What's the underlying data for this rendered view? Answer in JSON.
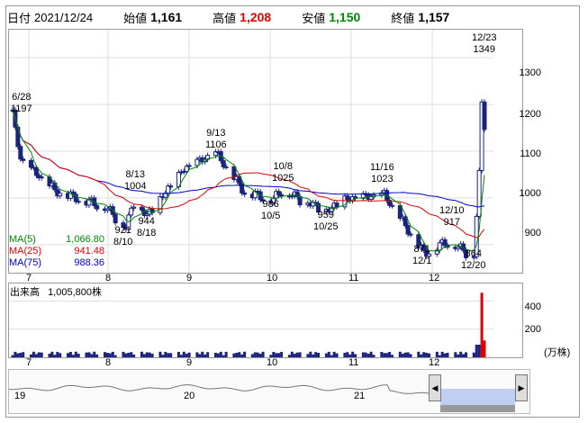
{
  "header": {
    "date_label": "日付",
    "date_value": "2021/12/24",
    "open_label": "始値",
    "open_value": "1,161",
    "high_label": "高値",
    "high_value": "1,208",
    "low_label": "安値",
    "low_value": "1,150",
    "close_label": "終値",
    "close_value": "1,157"
  },
  "price_axis": [
    "1300",
    "1200",
    "1100",
    "1000",
    "900"
  ],
  "month_labels": [
    "7",
    "8",
    "9",
    "10",
    "11",
    "12"
  ],
  "annotations": [
    {
      "text": "6/28\n1197"
    },
    {
      "text": "8/13\n1004"
    },
    {
      "text": "9/13\n1106"
    },
    {
      "text": "10/8\n1025"
    },
    {
      "text": "11/16\n1023"
    },
    {
      "text": "12/23\n1349"
    },
    {
      "text": "921\n8/10"
    },
    {
      "text": "944\n8/18"
    },
    {
      "text": "986\n10/5"
    },
    {
      "text": "959\n10/25"
    },
    {
      "text": "12/10\n917"
    },
    {
      "text": "871\n12/1"
    },
    {
      "text": "864\n12/20"
    }
  ],
  "ma": [
    {
      "label": "MA(5)",
      "value": "1,066.80",
      "color": "#008800"
    },
    {
      "label": "MA(25)",
      "value": "941.48",
      "color": "#e00000"
    },
    {
      "label": "MA(75)",
      "value": "988.36",
      "color": "#0000cc"
    }
  ],
  "volume": {
    "title": "出来高",
    "value": "1,005,800株",
    "axis": [
      "400",
      "200"
    ],
    "unit": "(万株)"
  },
  "nav": {
    "year_labels": [
      "19",
      "20",
      "21"
    ]
  },
  "colors": {
    "candle_up": "#ffffff",
    "candle_down": "#1a237e",
    "ma5": "#008800",
    "ma25": "#e00000",
    "ma75": "#0000cc",
    "volume": "#1a237e",
    "volume_hi": "#e00000",
    "nav_fill": "#b0c4f0"
  },
  "chart_data": {
    "type": "candlestick",
    "x": [
      "2021-06-28",
      "2021-07-01",
      "2021-07-15",
      "2021-08-02",
      "2021-08-10",
      "2021-08-13",
      "2021-08-18",
      "2021-09-01",
      "2021-09-13",
      "2021-09-24",
      "2021-10-05",
      "2021-10-08",
      "2021-10-25",
      "2021-11-01",
      "2021-11-16",
      "2021-12-01",
      "2021-12-10",
      "2021-12-20",
      "2021-12-22",
      "2021-12-23",
      "2021-12-24"
    ],
    "close": [
      1180,
      1080,
      1010,
      980,
      935,
      990,
      960,
      1060,
      1095,
      1010,
      995,
      1015,
      970,
      995,
      1005,
      880,
      905,
      875,
      1050,
      1200,
      1157
    ],
    "ylim": [
      840,
      1360
    ],
    "volume_ylim": [
      0,
      500
    ]
  }
}
